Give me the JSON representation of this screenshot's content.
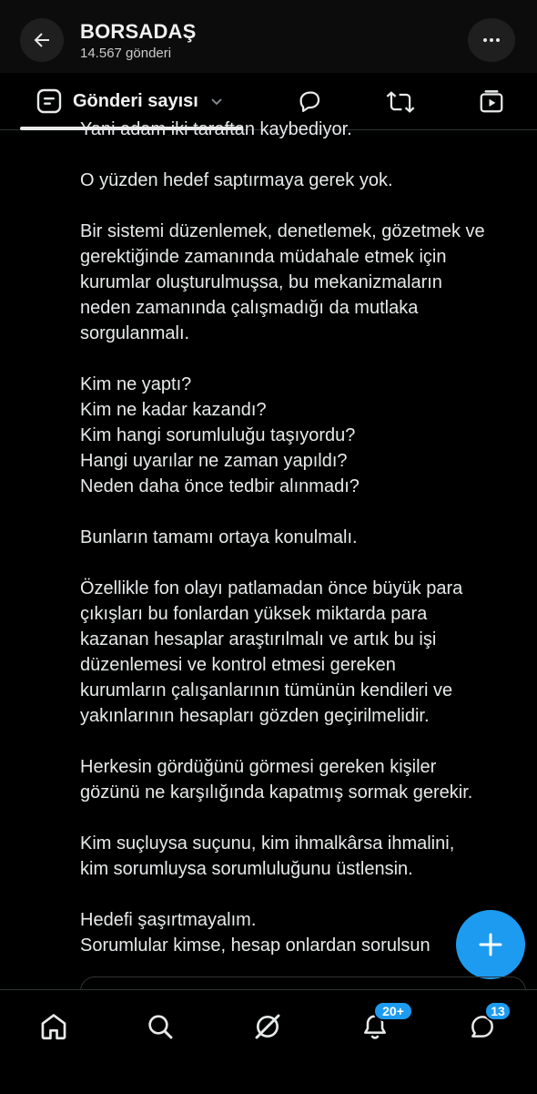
{
  "header": {
    "title": "BORSADAŞ",
    "subtitle": "14.567 gönderi",
    "back_icon": "arrow-left-icon",
    "more_icon": "more-horizontal-icon"
  },
  "subbar": {
    "tab_label": "Gönderi sayısı",
    "tab_icon": "posts-icon",
    "icons": [
      "reply-icon",
      "retweet-icon",
      "media-icon"
    ]
  },
  "content": {
    "paragraphs": [
      [
        "Yani adam iki taraftan kaybediyor."
      ],
      [
        "O yüzden hedef saptırmaya gerek yok."
      ],
      [
        "Bir sistemi düzenlemek, denetlemek, gözetmek ve",
        "gerektiğinde zamanında müdahale etmek için",
        "kurumlar oluşturulmuşsa, bu mekanizmaların",
        "neden zamanında çalışmadığı da mutlaka",
        "sorgulanmalı."
      ],
      [
        "Kim ne yaptı?",
        "Kim ne kadar kazandı?",
        "Kim hangi sorumluluğu taşıyordu?",
        "Hangi uyarılar ne zaman yapıldı?",
        "Neden daha önce tedbir alınmadı?"
      ],
      [
        "Bunların tamamı ortaya konulmalı."
      ],
      [
        "Özellikle fon olayı patlamadan önce büyük para",
        "çıkışları bu fonlardan yüksek miktarda para",
        "kazanan hesaplar araştırılmalı ve artık bu işi",
        "düzenlemesi ve kontrol etmesi gereken",
        "kurumların çalışanlarının tümünün kendileri ve",
        "yakınlarının hesapları gözden geçirilmelidir."
      ],
      [
        "Herkesin gördüğünü görmesi gereken kişiler",
        "gözünü ne karşılığında kapatmış sormak gerekir."
      ],
      [
        "Kim suçluysa suçunu, kim ihmalkârsa ihmalini,",
        "kim sorumluysa sorumluluğunu üstlensin."
      ],
      [
        "Hedefi şaşırtmayalım.",
        "Sorumlular kimse, hesap onlardan sorulsun"
      ]
    ]
  },
  "fab": {
    "icon": "plus-icon"
  },
  "bottom_nav": {
    "items": [
      "home-icon",
      "search-icon",
      "grok-icon",
      "notifications-icon",
      "messages-icon"
    ],
    "notifications_badge": "20+",
    "messages_badge": "13"
  },
  "colors": {
    "accent": "#1d9bf0",
    "background": "#000000",
    "text": "#e7e9ea"
  }
}
